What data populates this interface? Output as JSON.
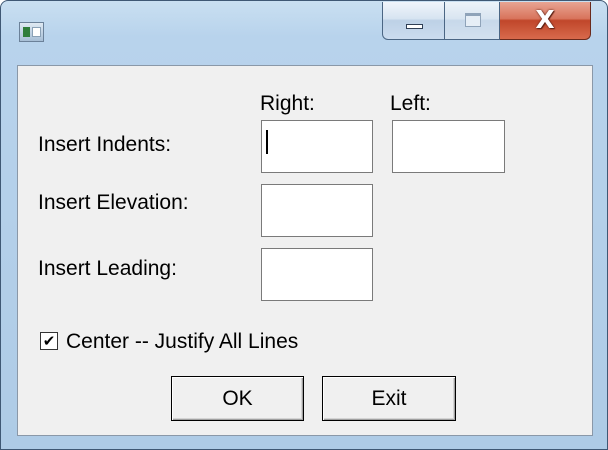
{
  "window": {
    "title": "",
    "icon": "app-window-icon",
    "caption_buttons": {
      "minimize_icon": "minimize-icon",
      "maximize_icon": "maximize-icon",
      "close_icon": "close-icon",
      "close_glyph": "X"
    }
  },
  "form": {
    "indents_label": "Insert Indents:",
    "right_header": "Right:",
    "left_header": "Left:",
    "indent_right_value": "",
    "indent_left_value": "",
    "elevation_label": "Insert Elevation:",
    "elevation_value": "",
    "leading_label": "Insert Leading:",
    "leading_value": "",
    "center_justify_label": "Center -- Justify  All  Lines",
    "center_justify_checked": true,
    "check_glyph": "✔"
  },
  "buttons": {
    "ok_label": "OK",
    "exit_label": "Exit"
  },
  "colors": {
    "close_button": "#c0462a",
    "title_bar": "#b8d3ec",
    "client_background": "#f0f0f0"
  }
}
